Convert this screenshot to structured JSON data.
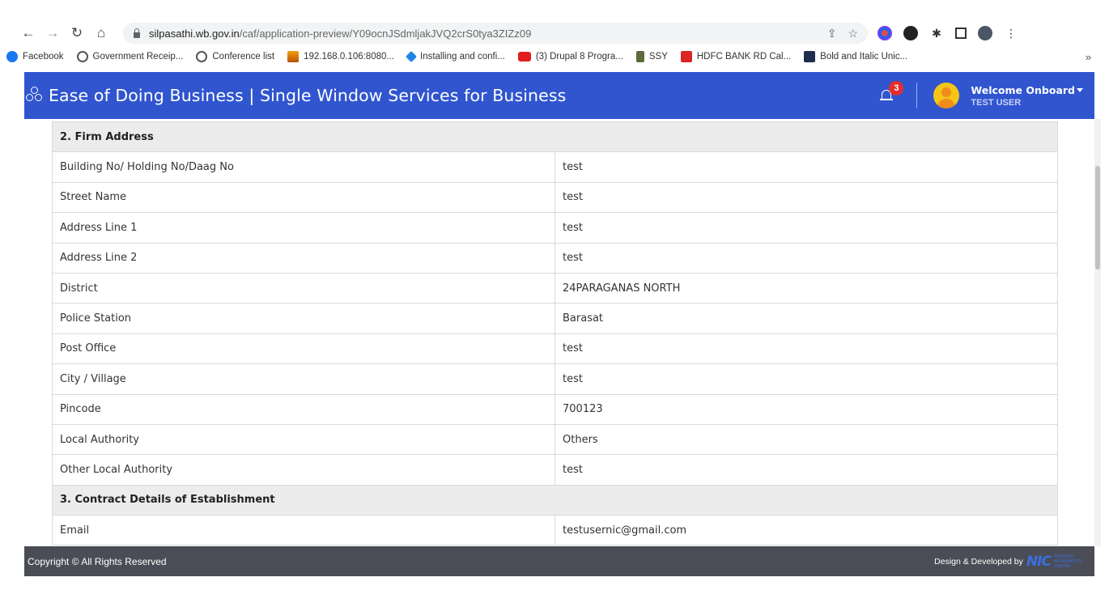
{
  "browser": {
    "url_host": "silpasathi.wb.gov.in",
    "url_path": "/caf/application-preview/Y09ocnJSdmljakJVQ2crS0tya3ZIZz09",
    "bookmarks": [
      {
        "label": "Facebook",
        "icon": "facebook-icon"
      },
      {
        "label": "Government Receip...",
        "icon": "globe-icon"
      },
      {
        "label": "Conference list",
        "icon": "globe-icon"
      },
      {
        "label": "192.168.0.106:8080...",
        "icon": "ama-icon"
      },
      {
        "label": "Installing and confi...",
        "icon": "drupal-icon"
      },
      {
        "label": "(3) Drupal 8 Progra...",
        "icon": "youtube-icon"
      },
      {
        "label": "SSY",
        "icon": "emblem-icon"
      },
      {
        "label": "HDFC BANK RD Cal...",
        "icon": "et-icon"
      },
      {
        "label": "Bold and Italic Unic...",
        "icon": "maytext-icon"
      }
    ],
    "bookmarks_more": "»"
  },
  "header": {
    "title": "Ease of Doing Business | Single Window Services for Business",
    "notification_count": "3",
    "welcome": "Welcome Onboard",
    "user_name": "TEST USER",
    "color": "#3055cf"
  },
  "sections": [
    {
      "title": "2. Firm Address",
      "rows": [
        {
          "label": "Building No/ Holding No/Daag No",
          "value": "test"
        },
        {
          "label": "Street Name",
          "value": "test"
        },
        {
          "label": "Address Line 1",
          "value": "test"
        },
        {
          "label": "Address Line 2",
          "value": "test"
        },
        {
          "label": "District",
          "value": "24PARAGANAS NORTH"
        },
        {
          "label": "Police Station",
          "value": "Barasat"
        },
        {
          "label": "Post Office",
          "value": "test"
        },
        {
          "label": "City / Village",
          "value": "test"
        },
        {
          "label": "Pincode",
          "value": "700123"
        },
        {
          "label": "Local Authority",
          "value": "Others"
        },
        {
          "label": "Other Local Authority",
          "value": "test"
        }
      ]
    },
    {
      "title": "3. Contract Details of Establishment",
      "rows": [
        {
          "label": "Email",
          "value": "testusernic@gmail.com"
        }
      ]
    }
  ],
  "footer": {
    "copyright": "Copyright © All Rights Reserved",
    "developed_by": "Design & Developed by",
    "nic": "NIC",
    "nic_line1": "NATIONAL",
    "nic_line2": "INFORMATICS",
    "nic_line3": "CENTRE"
  }
}
